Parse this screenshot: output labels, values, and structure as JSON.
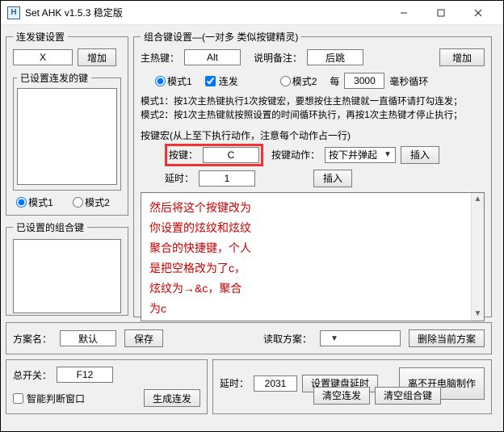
{
  "titlebar": {
    "icon_text": "H",
    "title": "Set AHK v1.5.3 稳定版"
  },
  "left": {
    "group1_legend": "连发键设置",
    "hotkey_value": "X",
    "add_btn": "增加",
    "group2_legend": "已设置连发的键",
    "mode1": "模式1",
    "mode2": "模式2",
    "group3_legend": "已设置的组合键"
  },
  "right": {
    "group_legend": "组合键设置—(一对多 类似按键精灵)",
    "main_hotkey_label": "主热键：",
    "main_hotkey_value": "Alt",
    "desc_label": "说明备注：",
    "desc_value": "后跳",
    "add_btn": "增加",
    "mode1": "模式1",
    "repeat_chk": "连发",
    "mode2": "模式2",
    "every_label": "每",
    "every_value": "3000",
    "every_unit": "毫秒循环",
    "explain": "模式1：按1次主热键执行1次按键宏，要想按住主热键就一直循环请打勾连发；\n模式2：按1次主热键就按照设置的时间循环执行，再按1次主热键才停止执行；",
    "macro_label": "按键宏(从上至下执行动作，注意每个动作占一行)",
    "key_label": "按键：",
    "key_value": "C",
    "action_label": "按键动作：",
    "action_value": "按下并弹起",
    "insert_btn": "插入",
    "delay_label": "延时：",
    "delay_value": "1",
    "insert_btn2": "插入",
    "textarea_content": "然后将这个按键改为\n你设置的炫纹和炫纹\n聚合的快捷键，个人\n是把空格改为了c，\n炫纹为→&c，聚合\n为c"
  },
  "scheme_row": {
    "name_label": "方案名：",
    "name_value": "默认",
    "save_btn": "保存",
    "load_label": "读取方案：",
    "delete_btn": "删除当前方案"
  },
  "bottom_left": {
    "switch_label": "总开关：",
    "switch_value": "F12",
    "smart_chk": "智能判断窗口",
    "gen_btn": "生成连发"
  },
  "bottom_right": {
    "delay_label": "延时：",
    "delay_value": "2031",
    "set_kbd_delay_btn": "设置键盘延时",
    "clear_repeat_btn": "清空连发",
    "clear_combo_btn": "清空组合键",
    "away_btn": "离不开电脑制作"
  }
}
